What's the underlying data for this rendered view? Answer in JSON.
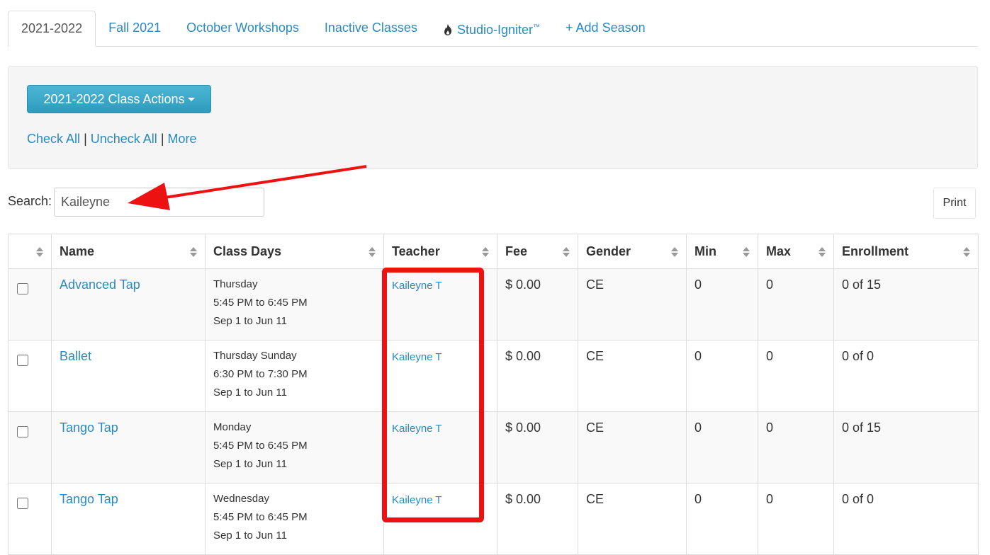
{
  "tabs": [
    {
      "label": "2021-2022",
      "active": true
    },
    {
      "label": "Fall 2021"
    },
    {
      "label": "October Workshops"
    },
    {
      "label": "Inactive Classes"
    },
    {
      "label": "Studio-Igniter",
      "sup": "™"
    },
    {
      "label": "+ Add Season"
    }
  ],
  "actions": {
    "button_label": "2021-2022 Class Actions",
    "check_all": "Check All",
    "uncheck_all": "Uncheck All",
    "more": "More",
    "separator": "|"
  },
  "search": {
    "label": "Search:",
    "value": "Kaileyne"
  },
  "print_label": "Print",
  "table": {
    "headers": [
      "",
      "Name",
      "Class Days",
      "Teacher",
      "Fee",
      "Gender",
      "Min",
      "Max",
      "Enrollment"
    ],
    "rows": [
      {
        "name": "Advanced Tap",
        "days": "Thursday",
        "time": "5:45 PM to 6:45 PM",
        "dates": "Sep 1 to Jun 11",
        "teacher": "Kaileyne T",
        "fee": "$ 0.00",
        "gender": "CE",
        "min": "0",
        "max": "0",
        "enrollment": "0 of 15"
      },
      {
        "name": "Ballet",
        "days": "Thursday Sunday",
        "time": "6:30 PM to 7:30 PM",
        "dates": "Sep 1 to Jun 11",
        "teacher": "Kaileyne T",
        "fee": "$ 0.00",
        "gender": "CE",
        "min": "0",
        "max": "0",
        "enrollment": "0 of 0"
      },
      {
        "name": "Tango Tap",
        "days": "Monday",
        "time": "5:45 PM to 6:45 PM",
        "dates": "Sep 1 to Jun 11",
        "teacher": "Kaileyne T",
        "fee": "$ 0.00",
        "gender": "CE",
        "min": "0",
        "max": "0",
        "enrollment": "0 of 15"
      },
      {
        "name": "Tango Tap",
        "days": "Wednesday",
        "time": "5:45 PM to 6:45 PM",
        "dates": "Sep 1 to Jun 11",
        "teacher": "Kaileyne T",
        "fee": "$ 0.00",
        "gender": "CE",
        "min": "0",
        "max": "0",
        "enrollment": "0 of 0"
      }
    ]
  },
  "colors": {
    "link": "#2a8ac0",
    "button": "#3ba6c6",
    "annotation": "#ee1111"
  }
}
